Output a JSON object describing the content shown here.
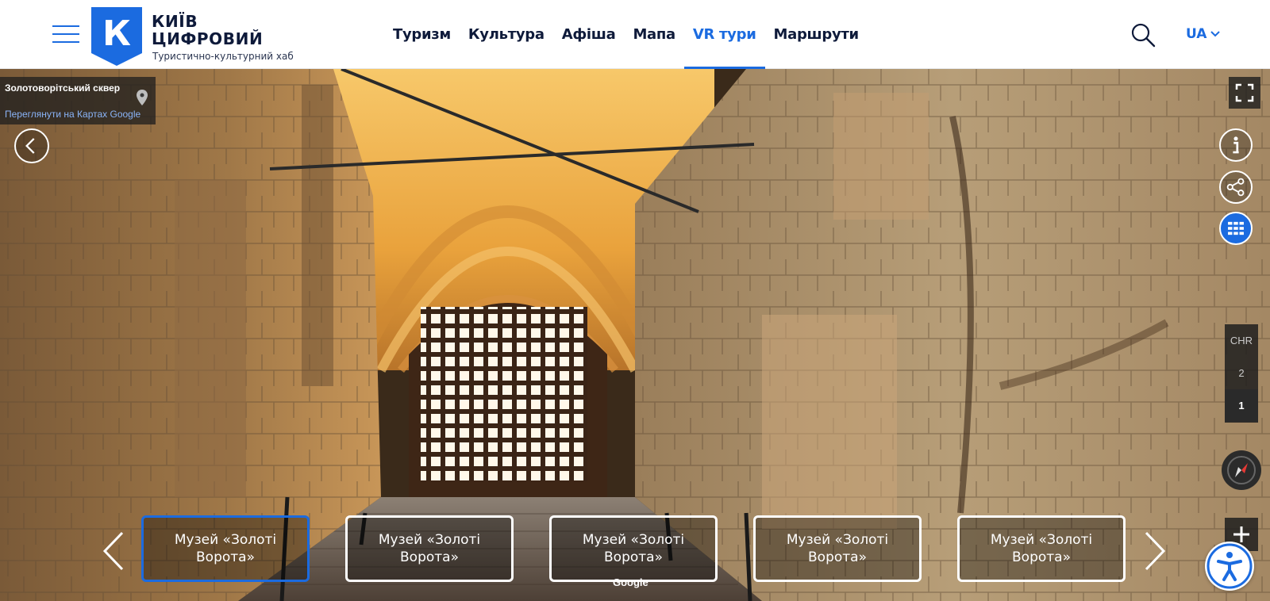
{
  "header": {
    "logo_letter": "К",
    "logo_line1": "КИЇВ",
    "logo_line2": "ЦИФРОВИЙ",
    "logo_subtitle": "Туристично-культурний хаб",
    "nav": [
      {
        "label": "Туризм",
        "active": false
      },
      {
        "label": "Культура",
        "active": false
      },
      {
        "label": "Афіша",
        "active": false
      },
      {
        "label": "Мапа",
        "active": false
      },
      {
        "label": "VR тури",
        "active": true
      },
      {
        "label": "Маршрути",
        "active": false
      }
    ],
    "language": "UA",
    "icons": {
      "menu": "hamburger-icon",
      "search": "search-icon",
      "lang": "chevron-down-icon"
    }
  },
  "panorama": {
    "place_title": "Золотоворітський сквер",
    "place_link": "Переглянути на Картах Google",
    "floors": [
      "CHR",
      "2",
      "1"
    ],
    "selected_floor": "1",
    "google_mark": "Google",
    "controls": {
      "back": "chevron-left-icon",
      "fullscreen": "fullscreen-icon",
      "info": "info-icon",
      "share": "share-icon",
      "grid": "grid-icon",
      "compass": "compass-icon",
      "zoom_in": "plus-icon",
      "accessibility": "accessibility-icon"
    }
  },
  "carousel": {
    "cards": [
      {
        "line1": "Музей «Золоті",
        "line2": "Ворота»",
        "active": true
      },
      {
        "line1": "Музей «Золоті",
        "line2": "Ворота»",
        "active": false
      },
      {
        "line1": "Музей «Золоті",
        "line2": "Ворота»",
        "active": false
      },
      {
        "line1": "Музей «Золоті",
        "line2": "Ворота»",
        "active": false
      },
      {
        "line1": "Музей «Золоті",
        "line2": "Ворота»",
        "active": false
      }
    ]
  },
  "colors": {
    "accent": "#1b6be0",
    "text_dark": "#0e1a3a"
  }
}
